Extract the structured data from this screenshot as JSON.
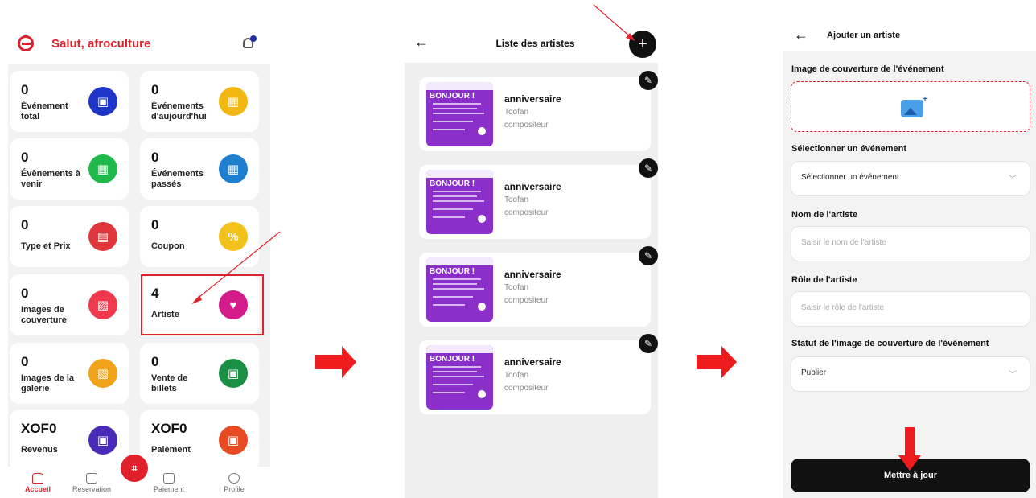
{
  "screen_dashboard": {
    "greeting": "Salut, afroculture",
    "cards": [
      {
        "value": "0",
        "label": "Événement total",
        "icon": "ticket-icon",
        "color": "#1e35c8"
      },
      {
        "value": "0",
        "label": "Événements d'aujourd'hui",
        "icon": "calendar-icon",
        "color": "#f2b711"
      },
      {
        "value": "0",
        "label": "Évènements à venir",
        "icon": "calendar-clock-icon",
        "color": "#1fb84a"
      },
      {
        "value": "0",
        "label": "Événements passés",
        "icon": "calendar-check-icon",
        "color": "#1f7fcf"
      },
      {
        "value": "0",
        "label": "Type et Prix",
        "icon": "price-tag-icon",
        "color": "#e0373c"
      },
      {
        "value": "0",
        "label": "Coupon",
        "icon": "coupon-icon",
        "color": "#f2c21b"
      },
      {
        "value": "0",
        "label": "Images de couverture",
        "icon": "image-icon",
        "color": "#ee3a4c"
      },
      {
        "value": "4",
        "label": "Artiste",
        "icon": "artist-icon",
        "color": "#d41b8c"
      },
      {
        "value": "0",
        "label": "Images de la galerie",
        "icon": "gallery-icon",
        "color": "#f0a21a"
      },
      {
        "value": "0",
        "label": "Vente de billets",
        "icon": "ticket-sale-icon",
        "color": "#1a8f43"
      },
      {
        "value": "XOF0",
        "label": "Revenus",
        "icon": "wallet-icon",
        "color": "#4a2bb8"
      },
      {
        "value": "XOF0",
        "label": "Paiement",
        "icon": "payment-icon",
        "color": "#e84b23"
      }
    ],
    "nav": [
      "Accueil",
      "Réservation",
      "Paiement",
      "Profile"
    ]
  },
  "screen_artists": {
    "title": "Liste des artistes",
    "poster_text": "BONJOUR !",
    "artists": [
      {
        "name": "anniversaire",
        "artist": "Toofan",
        "role": "compositeur"
      },
      {
        "name": "anniversaire",
        "artist": "Toofan",
        "role": "compositeur"
      },
      {
        "name": "anniversaire",
        "artist": "Toofan",
        "role": "compositeur"
      },
      {
        "name": "anniversaire",
        "artist": "Toofan",
        "role": "compositeur"
      }
    ]
  },
  "screen_form": {
    "title": "Ajouter un artiste",
    "cover_label": "Image de couverture de l'événement",
    "event_label": "Sélectionner un événement",
    "event_value": "Sélectionner un événement",
    "name_label": "Nom de l'artiste",
    "name_placeholder": "Saisir le nom de l'artiste",
    "role_label": "Rôle de l'artiste",
    "role_placeholder": "Saisir le rôle de l'artiste",
    "status_label": "Statut de l'image de couverture de l'événement",
    "status_value": "Publier",
    "submit_label": "Mettre à jour"
  },
  "colors": {
    "accent": "#e0212b",
    "dark": "#111111"
  }
}
